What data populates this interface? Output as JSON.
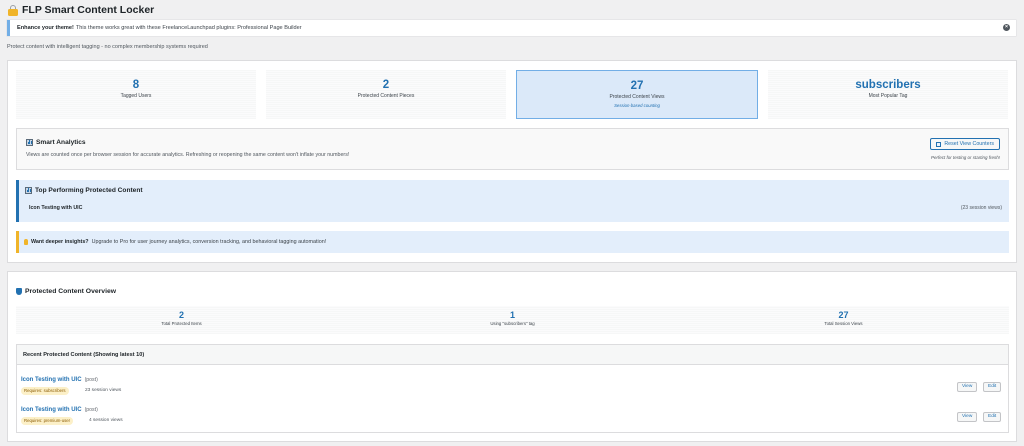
{
  "page": {
    "title": "FLP Smart Content Locker",
    "subtitle": "Protect content with intelligent tagging - no complex membership systems required"
  },
  "notice": {
    "bold": "Enhance your theme!",
    "text": "This theme works great with these FreelanceLaunchpad plugins: Professional Page Builder"
  },
  "stats": [
    {
      "value": "8",
      "label": "Tagged Users"
    },
    {
      "value": "2",
      "label": "Protected Content Pieces"
    },
    {
      "value": "27",
      "label": "Protected Content Views",
      "note": "Session-based counting"
    },
    {
      "value": "subscribers",
      "label": "Most Popular Tag"
    }
  ],
  "analytics": {
    "title": "Smart Analytics",
    "description": "Views are counted once per browser session for accurate analytics. Refreshing or reopening the same content won't inflate your numbers!",
    "reset_label": "Reset View Counters",
    "reset_note": "Perfect for testing or starting fresh!"
  },
  "top_content": {
    "title": "Top Performing Protected Content",
    "item": "Icon Testing with UIC",
    "views": "(23 session views)"
  },
  "upgrade": {
    "bold": "Want deeper insights?",
    "text": "Upgrade to Pro for user journey analytics, conversion tracking, and behavioral tagging automation!"
  },
  "overview": {
    "title": "Protected Content Overview",
    "stats": [
      {
        "value": "2",
        "label": "Total Protected Items"
      },
      {
        "value": "1",
        "label": "Using \"subscribers\" tag"
      },
      {
        "value": "27",
        "label": "Total Session Views"
      }
    ]
  },
  "recent": {
    "heading": "Recent Protected Content (Showing latest 10)",
    "view_label": "View",
    "edit_label": "Edit",
    "rows": [
      {
        "title": "Icon Testing with UIC",
        "type": "(post)",
        "badge": "Requires: subscribers",
        "views": "23 session views"
      },
      {
        "title": "Icon Testing with UIC",
        "type": "(post)",
        "badge": "Requires: premium-user",
        "views": "4 session views"
      }
    ]
  },
  "colors": {
    "accent": "#2271b1",
    "notice_border": "#72aee6",
    "badge_bg": "#fcf0c8",
    "lock": "#f0b429"
  }
}
